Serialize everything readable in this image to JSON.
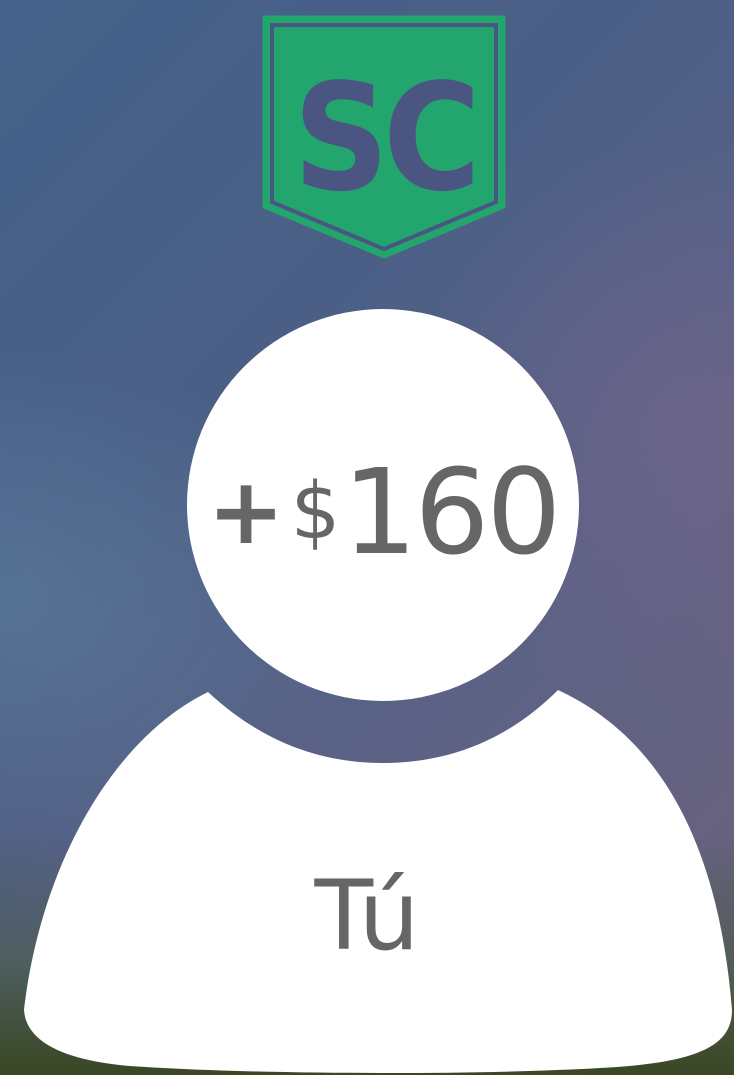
{
  "logo": {
    "text": "SC",
    "icon": "shield-logo",
    "colors": {
      "fill": "#22a66e",
      "text": "#4a5582"
    }
  },
  "reward": {
    "sign": "+",
    "currency": "$",
    "value": "160"
  },
  "user": {
    "name": "Tú"
  },
  "colors": {
    "avatar": "#ffffff",
    "text": "#666666"
  }
}
